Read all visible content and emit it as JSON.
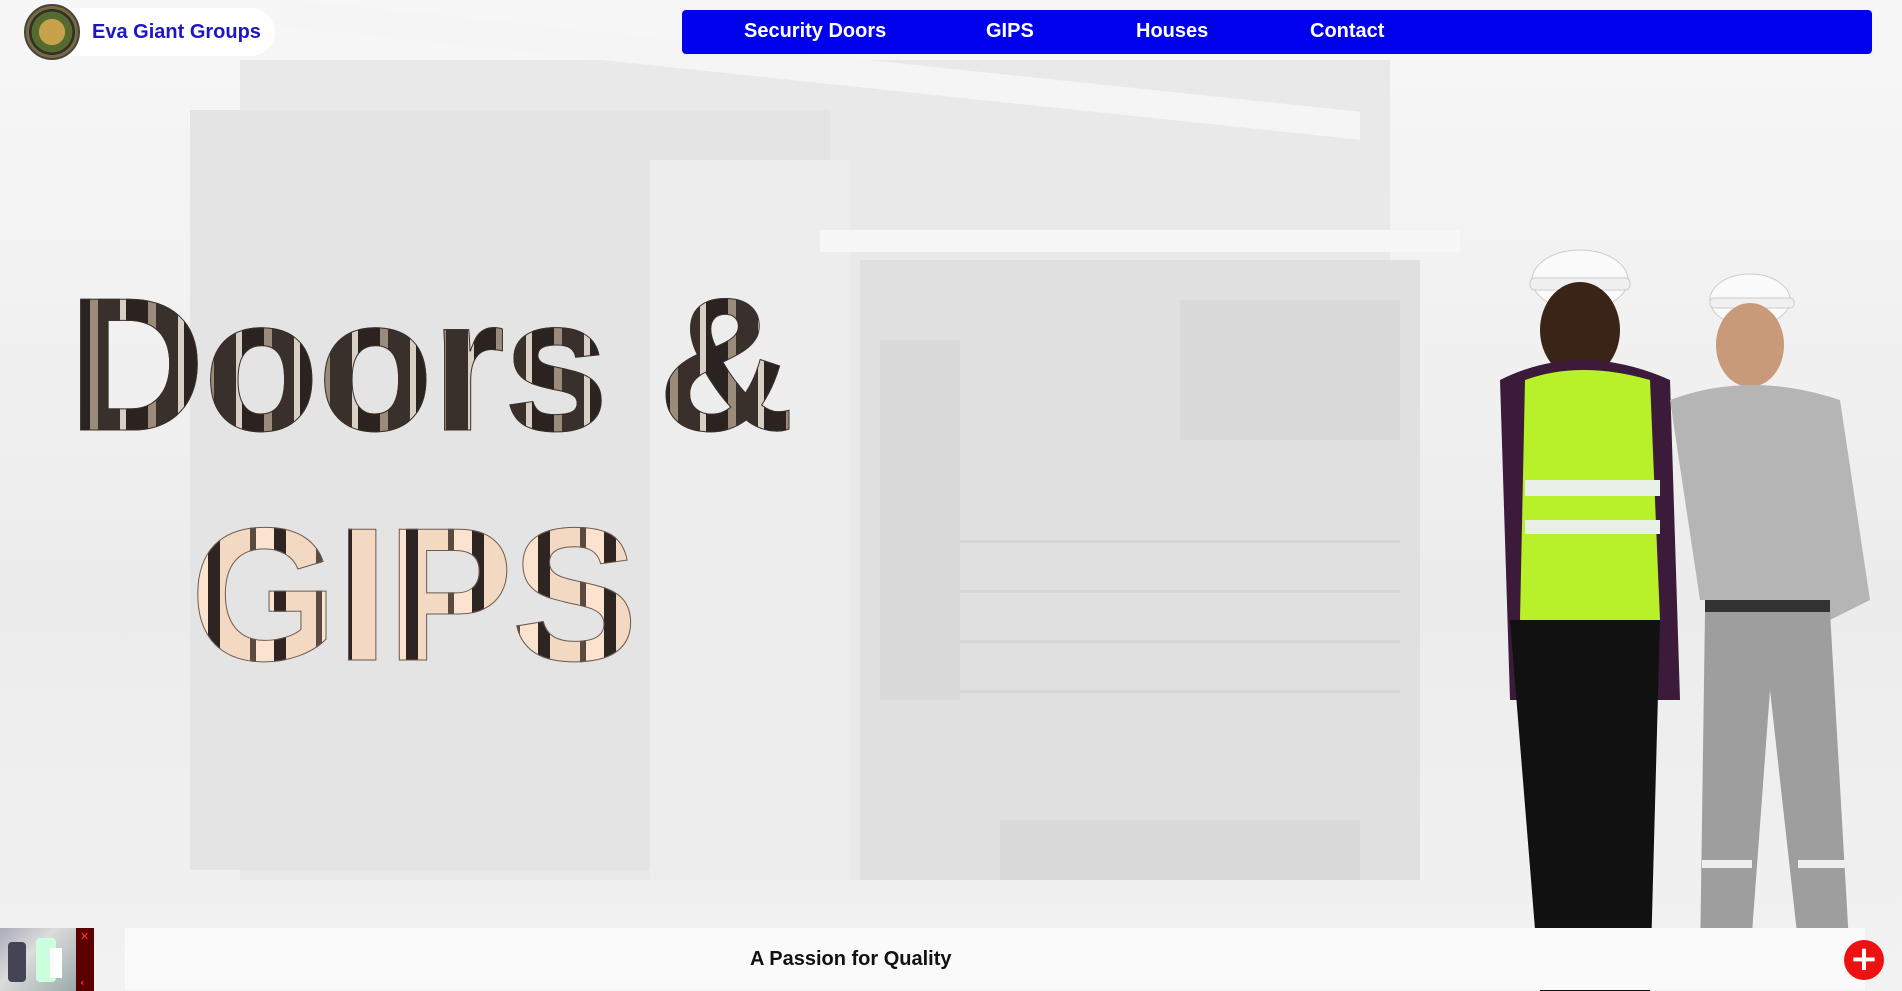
{
  "header": {
    "brand_name": "Eva Giant Groups",
    "logo_icon": "company-logo"
  },
  "nav": {
    "items": [
      {
        "label": "Security Doors"
      },
      {
        "label": "GIPS"
      },
      {
        "label": "Houses"
      },
      {
        "label": "Contact"
      }
    ],
    "background_color": "#0000ee"
  },
  "hero": {
    "line1": "Doors &",
    "line2": "GIPS"
  },
  "footer": {
    "tagline": "A Passion for Quality",
    "close_icon": "close-icon",
    "plus_icon": "plus-icon"
  },
  "colors": {
    "brand_text": "#1c16c7",
    "accent_red": "#ee1111"
  }
}
